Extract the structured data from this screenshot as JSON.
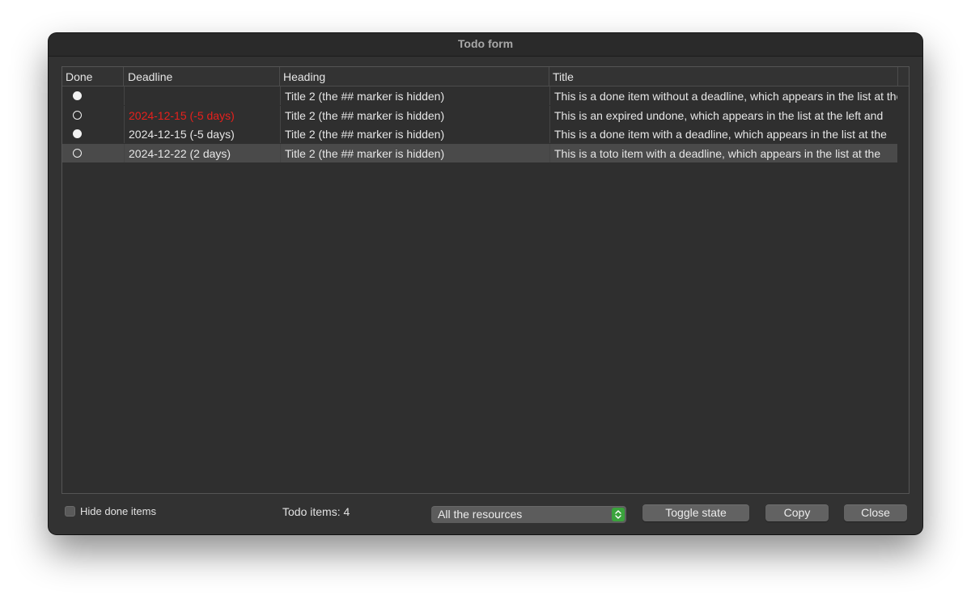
{
  "window": {
    "title": "Todo form"
  },
  "table": {
    "columns": [
      "Done",
      "Deadline",
      "Heading",
      "Title"
    ],
    "rows": [
      {
        "done": true,
        "deadline": "",
        "expired": false,
        "heading": "Title 2 (the ## marker is hidden)",
        "title": "This is a done item without a deadline, which appears in the list at the left and"
      },
      {
        "done": false,
        "deadline": "2024-12-15 (-5 days)",
        "expired": true,
        "heading": "Title 2 (the ## marker is hidden)",
        "title": "This is an expired undone, which appears in the list at the left and"
      },
      {
        "done": true,
        "deadline": "2024-12-15 (-5 days)",
        "expired": false,
        "heading": "Title 2 (the ## marker is hidden)",
        "title": "This is a done item with a deadline, which appears in the list at the"
      },
      {
        "done": false,
        "deadline": "2024-12-22 (2 days)",
        "expired": false,
        "heading": "Title 2 (the ## marker is hidden)",
        "title": "This is a toto item with a deadline, which appears in the list at the"
      }
    ],
    "selected_row": 3
  },
  "footer": {
    "hide_done_label": "Hide done items",
    "hide_done_checked": false,
    "count_label": "Todo items: 4",
    "resource_select": "All the resources",
    "toggle_label": "Toggle state",
    "copy_label": "Copy",
    "close_label": "Close"
  },
  "colors": {
    "expired_deadline": "#e8201c",
    "select_accent": "#3aa33c"
  }
}
